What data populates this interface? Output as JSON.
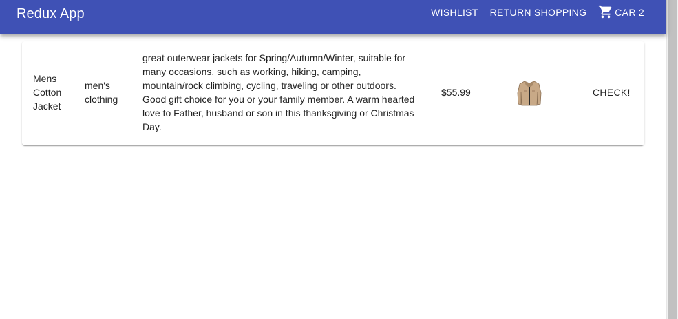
{
  "app": {
    "title": "Redux App"
  },
  "nav": {
    "wishlist": "WISHLIST",
    "return_shopping": "RETURN SHOPPING",
    "cart_label": "CAR 2"
  },
  "product": {
    "title": "Mens Cotton Jacket",
    "category": "men's clothing",
    "description": "great outerwear jackets for Spring/Autumn/Winter, suitable for many occasions, such as working, hiking, camping, mountain/rock climbing, cycling, traveling or other outdoors. Good gift choice for you or your family member. A warm hearted love to Father, husband or son in this thanksgiving or Christmas Day.",
    "price": "$55.99",
    "image_icon": "jacket-image",
    "check_label": "CHECK!"
  },
  "colors": {
    "appbar": "#3f51b5",
    "text": "#212121"
  },
  "icons": {
    "cart": "shopping-cart-icon"
  }
}
